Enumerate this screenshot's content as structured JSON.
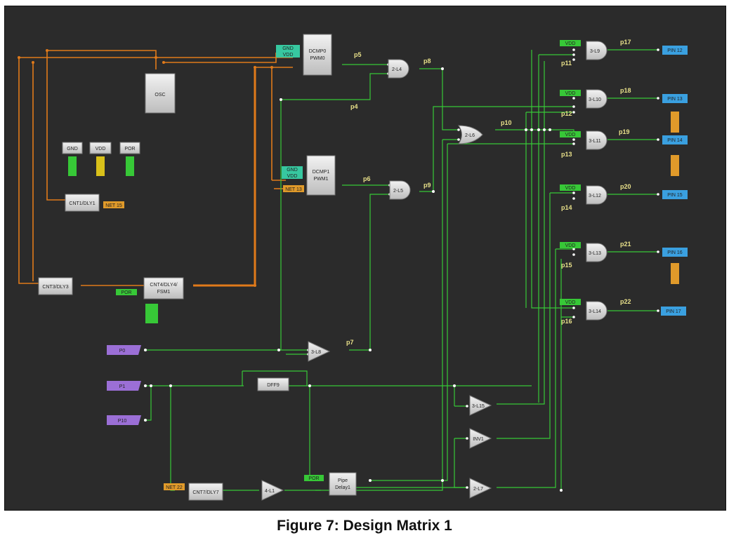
{
  "caption": "Figure 7: Design Matrix 1",
  "colors": {
    "background": "#2b2b2b",
    "wire_green": "#37c837",
    "wire_orange": "#e07a1a",
    "block_fill": "#d8d8d8",
    "pin_blue": "#3aa0e0",
    "input_purple": "#9b6fd6",
    "net_label": "#e8e089"
  },
  "blocks": {
    "osc": "OSC",
    "dcmp0": [
      "DCMP0",
      "PWM0"
    ],
    "dcmp1": [
      "DCMP1",
      "PWM1"
    ],
    "cnt1": "CNT1/DLY1",
    "cnt3": "CNT3/DLY3",
    "cnt4": [
      "CNT4/DLY4/",
      "FSM1"
    ],
    "cnt7": "CNT7/DLY7",
    "dff9": "DFF9",
    "pipe": [
      "Pipe",
      "Delay1"
    ],
    "power_gnd": "GND",
    "power_vdd": "VDD",
    "power_por": "POR"
  },
  "gates": {
    "l4": "2-L4",
    "l5": "2-L5",
    "l6": "2-L6",
    "l7": "2-L7",
    "l8": "3-L8",
    "l9": "3-L9",
    "l10": "3-L10",
    "l11": "3-L11",
    "l12": "3-L12",
    "l13": "3-L13",
    "l14": "3-L14",
    "l15": "3-L15",
    "inv1": "INV1",
    "l1": "4-L1"
  },
  "inputs": {
    "p0": "P0",
    "p1": "P1",
    "p10": "P10"
  },
  "outputs": {
    "pin12": "PIN 12",
    "pin13": "PIN 13",
    "pin14": "PIN 14",
    "pin15": "PIN 15",
    "pin16": "PIN 16",
    "pin17": "PIN 17"
  },
  "tags": {
    "gnd": "GND",
    "vdd": "VDD",
    "por": "POR",
    "net15": "NET 15",
    "net13": "NET 13",
    "net22": "NET 22"
  },
  "nets": {
    "p4": "p4",
    "p5": "p5",
    "p6": "p6",
    "p7": "p7",
    "p8": "p8",
    "p9": "p9",
    "p10": "p10",
    "p11": "p11",
    "p12": "p12",
    "p13": "p13",
    "p14": "p14",
    "p15": "p15",
    "p16": "p16",
    "p17": "p17",
    "p18": "p18",
    "p19": "p19",
    "p20": "p20",
    "p21": "p21",
    "p22": "p22"
  }
}
